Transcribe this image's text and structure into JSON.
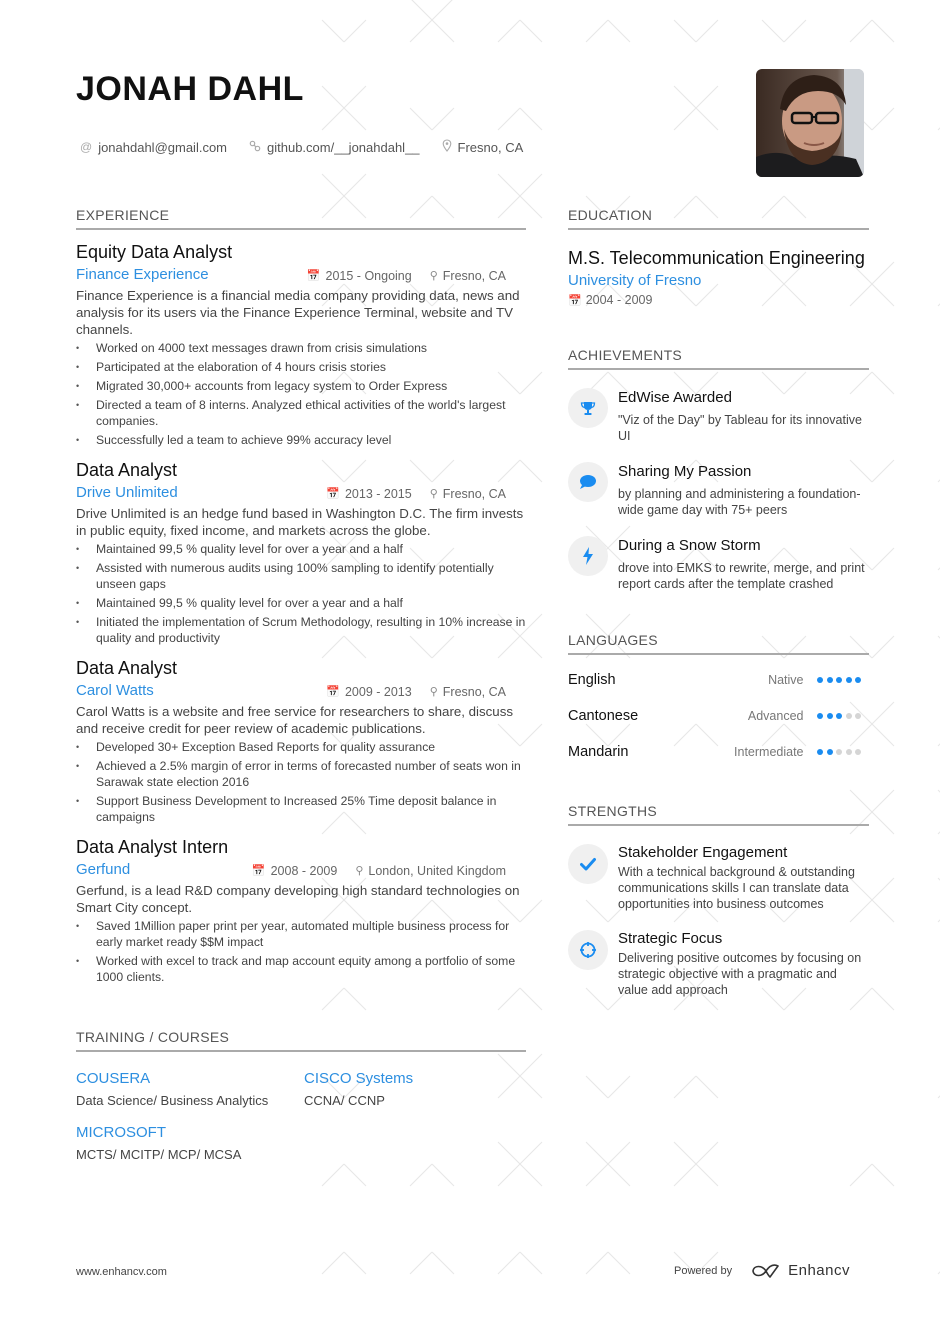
{
  "header": {
    "name": "JONAH DAHL",
    "contacts": [
      {
        "icon": "at-icon",
        "text": "jonahdahl@gmail.com"
      },
      {
        "icon": "link-icon",
        "text": "github.com/__jonahdahl__"
      },
      {
        "icon": "location-icon",
        "text": "Fresno, CA"
      }
    ]
  },
  "experience": {
    "title": "EXPERIENCE",
    "jobs": [
      {
        "title": "Equity Data Analyst",
        "company": "Finance Experience",
        "dates": "2015 - Ongoing",
        "location": "Fresno, CA",
        "description": "Finance Experience is a financial media company providing data, news and analysis for its users via the Finance Experience Terminal, website and TV channels.",
        "bullets": [
          "Worked on 4000 text messages drawn from crisis simulations",
          "Participated at the elaboration of 4 hours crisis stories",
          "Migrated 30,000+ accounts from legacy system to Order Express",
          "Directed a team of 8 interns. Analyzed ethical activities of the world's largest companies.",
          "Successfully led a team to achieve 99% accuracy level"
        ]
      },
      {
        "title": "Data Analyst",
        "company": "Drive Unlimited",
        "dates": "2013 - 2015",
        "location": "Fresno, CA",
        "description": "Drive Unlimited is an hedge fund based in Washington D.C. The firm invests in public equity, fixed income, and markets across the globe.",
        "bullets": [
          "Maintained 99,5 % quality level for over a year and a half",
          "Assisted with numerous audits using 100% sampling to identify potentially unseen gaps",
          "Maintained 99,5 % quality level for over a year and a half",
          "Initiated the implementation of Scrum Methodology, resulting in 10% increase in quality and productivity"
        ]
      },
      {
        "title": "Data Analyst",
        "company": "Carol Watts",
        "dates": "2009 - 2013",
        "location": "Fresno, CA",
        "description": "Carol Watts is a website and free service for researchers to share, discuss and receive credit for peer review of academic publications.",
        "bullets": [
          "Developed 30+ Exception Based Reports for quality assurance",
          "Achieved a 2.5% margin of error in terms of forecasted number of seats won in Sarawak state election 2016",
          "Support Business Development to Increased 25% Time deposit balance in campaigns"
        ]
      },
      {
        "title": "Data Analyst Intern",
        "company": "Gerfund",
        "dates": "2008 - 2009",
        "location": "London, United Kingdom",
        "description": "Gerfund, is a lead R&D company developing high standard technologies on Smart City concept.",
        "bullets": [
          "Saved 1Million paper print per year, automated multiple business process for early market ready $$M impact",
          "Worked with excel to track and map account equity among a portfolio of some 1000 clients."
        ]
      }
    ]
  },
  "training": {
    "title": "TRAINING / COURSES",
    "courses": [
      {
        "name": "COUSERA",
        "description": "Data Science/ Business Analytics"
      },
      {
        "name": "CISCO Systems",
        "description": "CCNA/ CCNP"
      },
      {
        "name": "MICROSOFT",
        "description": "MCTS/ MCITP/ MCP/ MCSA"
      }
    ]
  },
  "education": {
    "title": "EDUCATION",
    "degree": "M.S. Telecommunication Engineering",
    "school": "University of Fresno",
    "dates": "2004 - 2009"
  },
  "achievements": {
    "title": "ACHIEVEMENTS",
    "items": [
      {
        "icon": "trophy-icon",
        "title": "EdWise Awarded",
        "description": "\"Viz of the Day\" by Tableau for its innovative UI"
      },
      {
        "icon": "speech-bubble-icon",
        "title": "Sharing My Passion",
        "description": "by planning and administering a foundation-wide game day with 75+ peers"
      },
      {
        "icon": "lightning-icon",
        "title": "During a Snow Storm",
        "description": "drove into EMKS to rewrite, merge, and print report cards after the template crashed"
      }
    ]
  },
  "languages": {
    "title": "LANGUAGES",
    "items": [
      {
        "name": "English",
        "level": "Native",
        "rating": 5,
        "max": 5
      },
      {
        "name": "Cantonese",
        "level": "Advanced",
        "rating": 3,
        "max": 5
      },
      {
        "name": "Mandarin",
        "level": "Intermediate",
        "rating": 2,
        "max": 5
      }
    ]
  },
  "strengths": {
    "title": "STRENGTHS",
    "items": [
      {
        "icon": "checkmark-icon",
        "title": "Stakeholder Engagement",
        "description": "With a technical background & outstanding communications skills I can translate data opportunities into business outcomes"
      },
      {
        "icon": "crosshair-icon",
        "title": "Strategic Focus",
        "description": "Delivering positive outcomes by focusing on strategic objective with a pragmatic and value add approach"
      }
    ]
  },
  "footer": {
    "website": "www.enhancv.com",
    "powered_by": "Powered by",
    "brand": "Enhancv"
  },
  "colors": {
    "accent": "#2d8fe0",
    "icon_blue": "#1a8cf0",
    "dot_off": "#d5d5d5"
  }
}
